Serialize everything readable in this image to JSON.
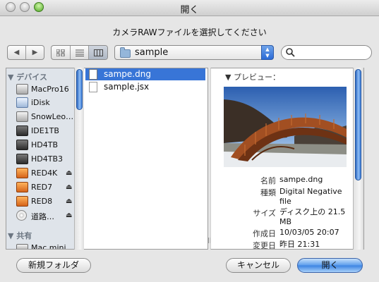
{
  "window": {
    "title": "開く",
    "prompt": "カメラRAWファイルを選択してください"
  },
  "toolbar": {
    "back_icon": "back-arrow-icon",
    "forward_icon": "forward-arrow-icon",
    "location": "sample",
    "search_placeholder": ""
  },
  "sidebar": {
    "sections": [
      {
        "label": "デバイス"
      },
      {
        "label": "共有"
      }
    ],
    "devices": [
      {
        "label": "MacPro16",
        "icon": "disk",
        "eject": false
      },
      {
        "label": "iDisk",
        "icon": "idisk",
        "eject": false
      },
      {
        "label": "SnowLeo…",
        "icon": "disk",
        "eject": false
      },
      {
        "label": "IDE1TB",
        "icon": "hdd",
        "eject": false
      },
      {
        "label": "HD4TB",
        "icon": "hdd",
        "eject": false
      },
      {
        "label": "HD4TB3",
        "icon": "hdd",
        "eject": false
      },
      {
        "label": "RED4K",
        "icon": "red",
        "eject": true
      },
      {
        "label": "RED7",
        "icon": "red",
        "eject": true
      },
      {
        "label": "RED8",
        "icon": "red",
        "eject": true
      },
      {
        "label": "道路…",
        "icon": "cd",
        "eject": true
      }
    ],
    "shared": [
      {
        "label": "Mac mini"
      }
    ],
    "eject_glyph": "⏏"
  },
  "files": [
    {
      "name": "sampe.dng",
      "selected": true
    },
    {
      "name": "sample.jsx",
      "selected": false
    }
  ],
  "preview": {
    "heading": "プレビュー：",
    "fields": [
      {
        "label": "名前",
        "value": "sampe.dng"
      },
      {
        "label": "種類",
        "value": "Digital Negative file"
      },
      {
        "label": "サイズ",
        "value": "ディスク上の 21.5 MB"
      },
      {
        "label": "作成日",
        "value": "10/03/05 20:07"
      },
      {
        "label": "変更日",
        "value": "昨日 21:31"
      }
    ]
  },
  "buttons": {
    "new_folder": "新規フォルダ",
    "cancel": "キャンセル",
    "open": "開く"
  },
  "colors": {
    "selection": "#3875d7",
    "sidebar_bg": "#dfe4ea",
    "window_bg": "#e6e6e6"
  }
}
